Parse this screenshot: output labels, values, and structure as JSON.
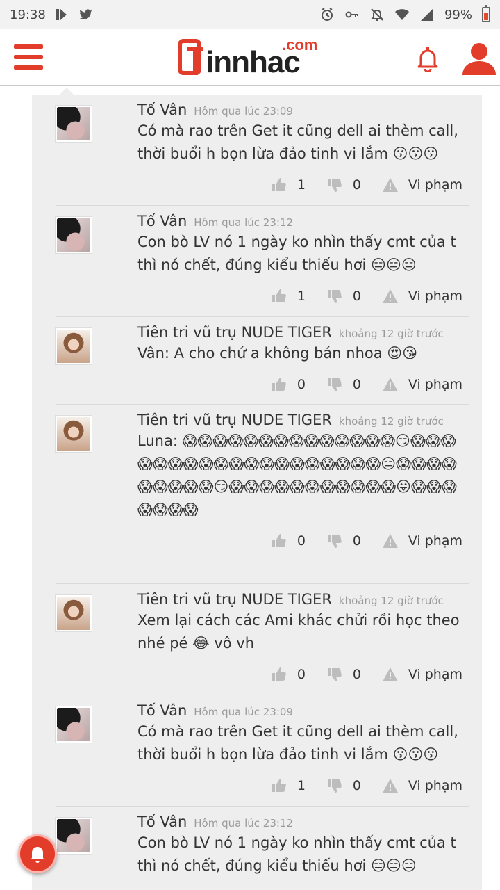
{
  "status_bar": {
    "time": "19:38",
    "battery": "99%"
  },
  "header": {
    "logo_main": "Tinnhac",
    "logo_word": "innhac",
    "logo_suffix": ".com",
    "accent_color": "#e23c2b"
  },
  "comments": [
    {
      "name": "Tố Vân",
      "time": "Hôm qua lúc 23:09",
      "text": "Có mà rao trên Get it cũng dell ai thèm call, thời buổi h bọn lừa đảo tinh vi lắm 😗😗😗",
      "likes": "1",
      "dislikes": "0",
      "report": "Vi phạm",
      "avatar": "girl-dark-hair"
    },
    {
      "name": "Tố Vân",
      "time": "Hôm qua lúc 23:12",
      "text": "Con bò LV nó 1 ngày ko nhìn thấy cmt của t thì nó chết, đúng kiểu thiếu hơi 😑😑😑",
      "likes": "1",
      "dislikes": "0",
      "report": "Vi phạm",
      "avatar": "girl-dark-hair"
    },
    {
      "name": "Tiên tri vũ trụ NUDE TIGER",
      "time": "khoảng 12 giờ trước",
      "text": "Vân: A cho chứ a không bán nhoa 😍😘",
      "likes": "0",
      "dislikes": "0",
      "report": "Vi phạm",
      "avatar": "girl-brown-hair"
    },
    {
      "name": "Tiên tri vũ trụ NUDE TIGER",
      "time": "khoảng 12 giờ trước",
      "text": "Luna: 😱😱😱😱😱😱😱😱😱😱😱😱😱😱😏😱😱😱😱😱😱😱😱😱😱😱😱😱😱😱😱😱😱😱😑😱😱😱😱😱😱😱😱😱😏😱😱😱😱😱😱😱😱😱😱😱😛😱😱😱😱😱😱😱",
      "likes": "0",
      "dislikes": "0",
      "report": "Vi phạm",
      "avatar": "girl-brown-hair"
    },
    {
      "name": "Tiên tri vũ trụ NUDE TIGER",
      "time": "khoảng 12 giờ trước",
      "text": "Xem lại cách các Ami khác chửi rồi học theo nhé pé 😂 vô vh",
      "likes": "0",
      "dislikes": "0",
      "report": "Vi phạm",
      "avatar": "girl-brown-hair"
    },
    {
      "name": "Tố Vân",
      "time": "Hôm qua lúc 23:09",
      "text": "Có mà rao trên Get it cũng dell ai thèm call, thời buổi h bọn lừa đảo tinh vi lắm 😗😗😗",
      "likes": "1",
      "dislikes": "0",
      "report": "Vi phạm",
      "avatar": "girl-dark-hair"
    },
    {
      "name": "Tố Vân",
      "time": "Hôm qua lúc 23:12",
      "text": "Con bò LV nó 1 ngày ko nhìn thấy cmt của t thì nó chết, đúng kiểu thiếu hơi 😑😑😑",
      "likes": "",
      "dislikes": "",
      "report": "",
      "avatar": "girl-dark-hair"
    }
  ]
}
